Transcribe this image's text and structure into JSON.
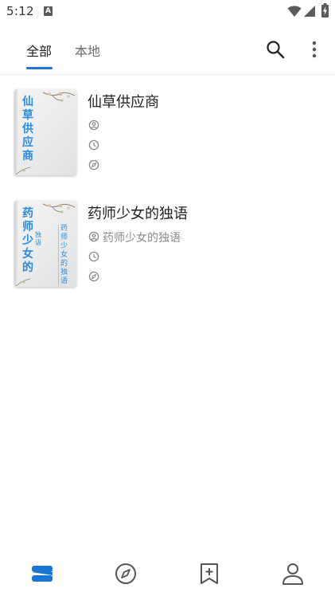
{
  "status_bar": {
    "time": "5:12",
    "notification_icon": "A"
  },
  "tabs": [
    {
      "label": "全部",
      "selected": true
    },
    {
      "label": "本地",
      "selected": false
    }
  ],
  "toolbar": {
    "search_icon": "search-icon",
    "more_icon": "more-vert-icon"
  },
  "books": [
    {
      "title": "仙草供应商",
      "author": "",
      "last_read": "",
      "source": "",
      "cover_title": "仙草供应商",
      "cover_subtitle": "",
      "cover_side_text": ""
    },
    {
      "title": "药师少女的独语",
      "author": "药师少女的独语",
      "last_read": "",
      "source": "",
      "cover_title": "药师少女的",
      "cover_subtitle": "独语",
      "cover_side_text": "药师少女的独语"
    }
  ],
  "bottom_nav": [
    {
      "name": "bookshelf",
      "icon": "bookshelf-icon",
      "active": true
    },
    {
      "name": "discover",
      "icon": "compass-icon",
      "active": false
    },
    {
      "name": "bookmarks",
      "icon": "bookmark-add-icon",
      "active": false
    },
    {
      "name": "profile",
      "icon": "person-icon",
      "active": false
    }
  ],
  "colors": {
    "accent": "#1976d2",
    "cover_text": "#2a8be0"
  }
}
